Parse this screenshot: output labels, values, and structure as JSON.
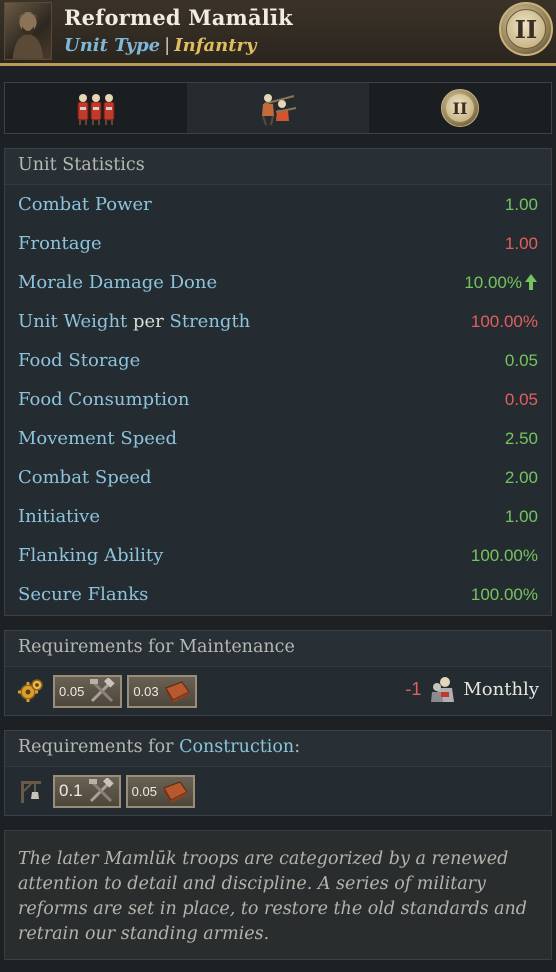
{
  "header": {
    "title": "Reformed Mamālīk",
    "type_label": "Unit Type",
    "separator": "|",
    "type_value": "Infantry",
    "tier": "II"
  },
  "tabs": [
    {
      "icon": "infantry-formation-icon"
    },
    {
      "icon": "soldiers-icon"
    },
    {
      "icon": "tier-badge-icon",
      "label": "II"
    }
  ],
  "stats": {
    "heading": "Unit Statistics",
    "rows": [
      {
        "name": "Combat Power",
        "value": "1.00",
        "color": "green"
      },
      {
        "name": "Frontage",
        "value": "1.00",
        "color": "red"
      },
      {
        "name": "Morale Damage Done",
        "value": "10.00%",
        "color": "green",
        "arrow": "up"
      },
      {
        "name_a": "Unit Weight",
        "name_mid": "per",
        "name_b": "Strength",
        "value": "100.00%",
        "color": "red"
      },
      {
        "name": "Food Storage",
        "value": "0.05",
        "color": "green"
      },
      {
        "name": "Food Consumption",
        "value": "0.05",
        "color": "red"
      },
      {
        "name": "Movement Speed",
        "value": "2.50",
        "color": "green"
      },
      {
        "name": "Combat Speed",
        "value": "2.00",
        "color": "green"
      },
      {
        "name": "Initiative",
        "value": "1.00",
        "color": "green"
      },
      {
        "name": "Flanking Ability",
        "value": "100.00%",
        "color": "green"
      },
      {
        "name": "Secure Flanks",
        "value": "100.00%",
        "color": "green"
      }
    ]
  },
  "maintenance": {
    "heading": "Requirements for Maintenance",
    "resources": [
      {
        "amount": "0.05",
        "icon": "tools-icon"
      },
      {
        "amount": "0.03",
        "icon": "leather-icon"
      }
    ],
    "cost": "-1",
    "period": "Monthly"
  },
  "construction": {
    "heading_a": "Requirements for",
    "heading_kw": "Construction",
    "heading_b": ":",
    "resources": [
      {
        "amount": "0.1",
        "icon": "tools-icon"
      },
      {
        "amount": "0.05",
        "icon": "leather-icon"
      }
    ]
  },
  "description": "The later Mamlūk troops are categorized by a renewed attention to detail and discipline. A series of military reforms are set in place, to restore the old standards and retrain our standing armies.",
  "colors": {
    "green": "#74c45e",
    "red": "#e25f5f",
    "accent": "#8cc4dd",
    "gold": "#e0bd5e"
  }
}
